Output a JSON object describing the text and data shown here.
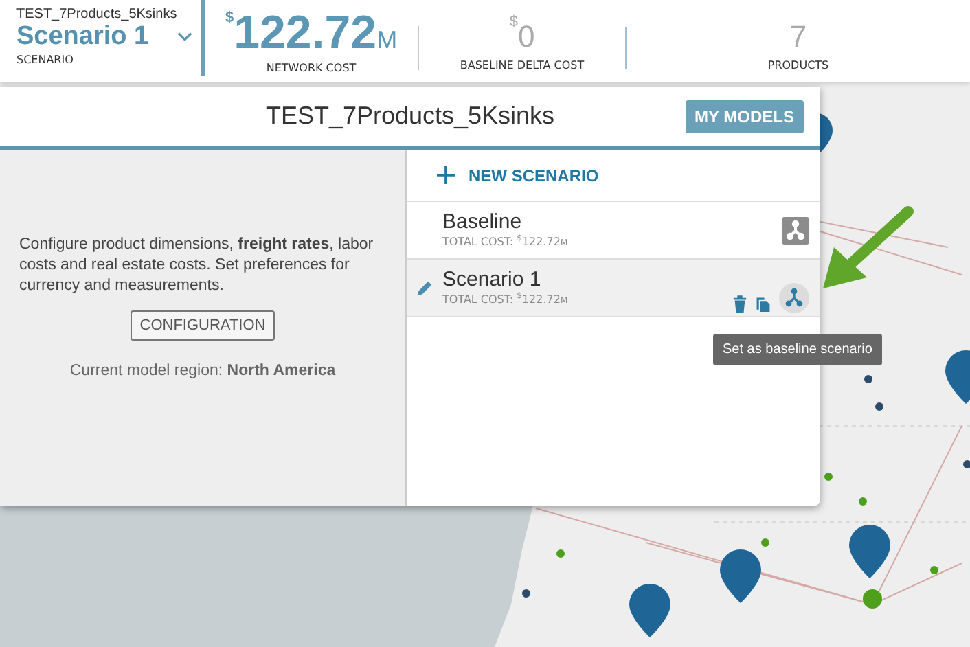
{
  "header": {
    "model_name": "TEST_7Products_5Ksinks",
    "scenario": "Scenario 1",
    "scenario_label": "SCENARIO",
    "metrics": [
      {
        "currency": "$",
        "value": "122.72",
        "unit": "M",
        "label": "NETWORK COST",
        "highlighted": true
      },
      {
        "currency": "$",
        "value": "0",
        "label": "BASELINE DELTA COST",
        "highlighted": false
      },
      {
        "value": "7",
        "label": "PRODUCTS",
        "highlighted": false
      }
    ]
  },
  "modal": {
    "title": "TEST_7Products_5Ksinks",
    "models_button": "MY MODELS",
    "description": "Configure product dimensions, **freight rates**, labor costs and real estate costs. Set preferences for currency and measurements.",
    "config_button": "CONFIGURATION",
    "region": "Current model region: **North America**",
    "new_scenario": "NEW SCENARIO",
    "scenarios": [
      {
        "kind": "baseline",
        "name": "Baseline",
        "cost_label": "TOTAL COST:",
        "currency": "$",
        "value": "122.72",
        "unit": "M",
        "selected": false
      },
      {
        "kind": "scenario",
        "name": "Scenario 1",
        "cost_label": "TOTAL COST:",
        "currency": "$",
        "value": "122.72",
        "unit": "M",
        "selected": true
      }
    ],
    "tooltip": "Set as baseline scenario"
  }
}
